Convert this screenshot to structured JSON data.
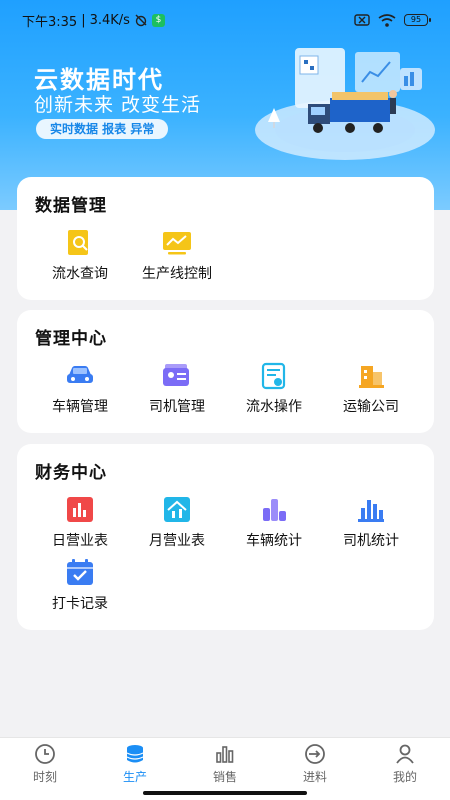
{
  "status": {
    "time": "下午3:35",
    "speed": "3.4K/s",
    "battery": "95"
  },
  "hero": {
    "title": "云数据时代",
    "subtitle": "创新未来  改变生活",
    "tag": "实时数据  报表  异常"
  },
  "sections": {
    "data": {
      "title": "数据管理",
      "items": [
        {
          "label": "流水查询",
          "icon": "search-doc-icon"
        },
        {
          "label": "生产线控制",
          "icon": "line-monitor-icon"
        }
      ]
    },
    "mgmt": {
      "title": "管理中心",
      "items": [
        {
          "label": "车辆管理",
          "icon": "car-icon"
        },
        {
          "label": "司机管理",
          "icon": "id-card-icon"
        },
        {
          "label": "流水操作",
          "icon": "flow-doc-icon"
        },
        {
          "label": "运输公司",
          "icon": "building-icon"
        }
      ]
    },
    "finance": {
      "title": "财务中心",
      "items": [
        {
          "label": "日营业表",
          "icon": "bar-chart-red-icon"
        },
        {
          "label": "月营业表",
          "icon": "house-chart-icon"
        },
        {
          "label": "车辆统计",
          "icon": "blocks-chart-icon"
        },
        {
          "label": "司机统计",
          "icon": "bar-chart-blue-icon"
        },
        {
          "label": "打卡记录",
          "icon": "calendar-check-icon"
        }
      ]
    }
  },
  "tabs": [
    {
      "label": "时刻",
      "icon": "clock-icon",
      "active": false
    },
    {
      "label": "生产",
      "icon": "database-icon",
      "active": true
    },
    {
      "label": "销售",
      "icon": "bar-icon",
      "active": false
    },
    {
      "label": "进料",
      "icon": "import-icon",
      "active": false
    },
    {
      "label": "我的",
      "icon": "user-icon",
      "active": false
    }
  ],
  "colors": {
    "accent": "#1b8ef5",
    "hero_top": "#1fa0ff",
    "yellow": "#f5c518",
    "red": "#f04848",
    "blue": "#3a7cf2",
    "cyan": "#21b6e8",
    "orange": "#f5a623",
    "purple": "#7b6cf6"
  }
}
